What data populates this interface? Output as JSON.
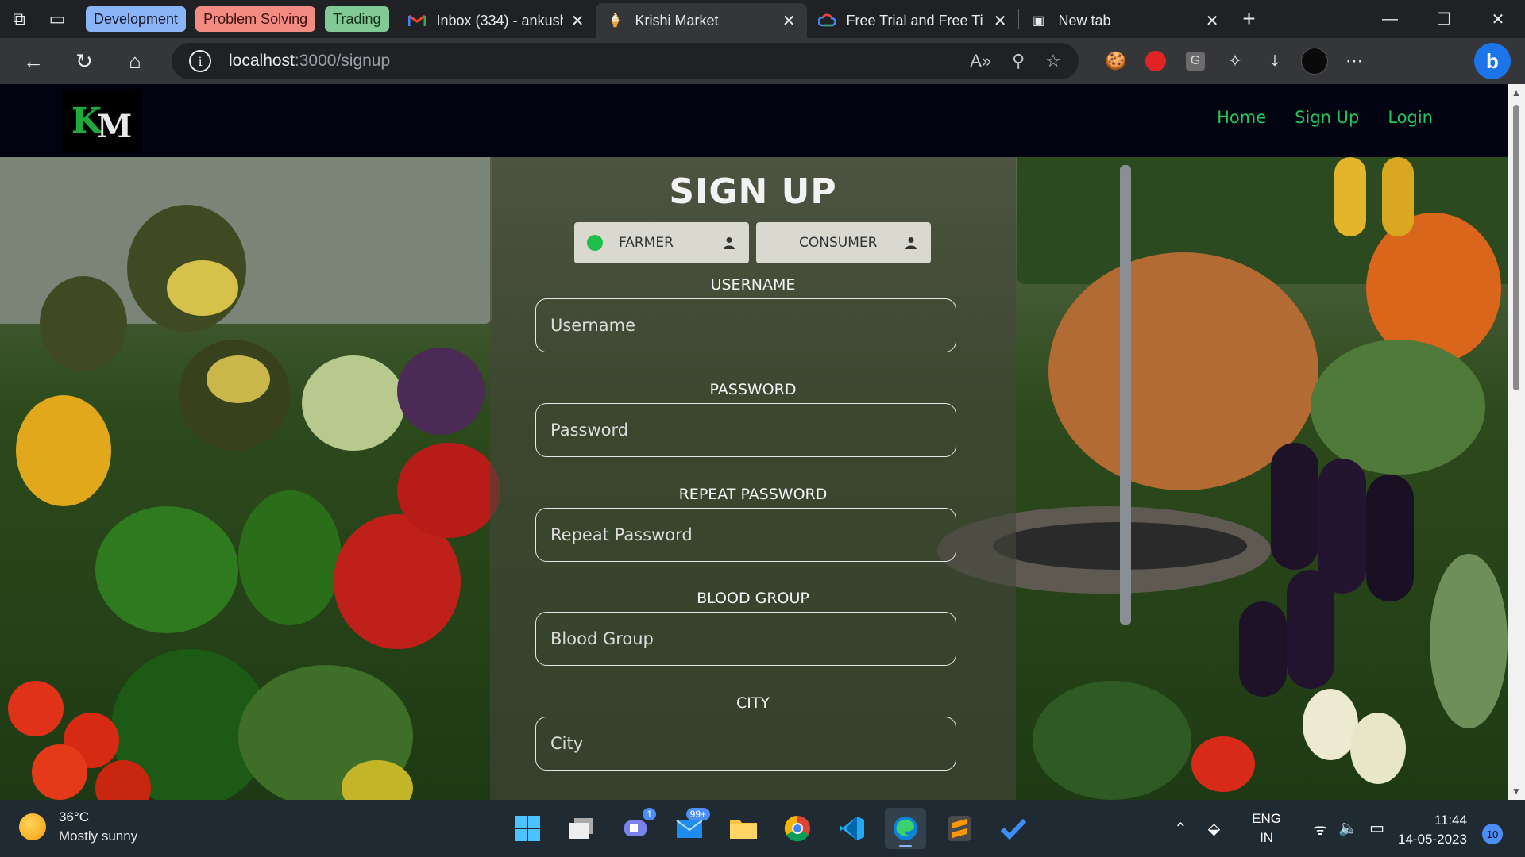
{
  "browser": {
    "tab_groups": [
      {
        "label": "Development"
      },
      {
        "label": "Problem Solving"
      },
      {
        "label": "Trading"
      }
    ],
    "tabs": [
      {
        "title": "Inbox (334) - ankushl"
      },
      {
        "title": "Krishi Market"
      },
      {
        "title": "Free Trial and Free Ti"
      },
      {
        "title": "New tab"
      }
    ],
    "address": {
      "host": "localhost",
      "path": ":3000/signup"
    }
  },
  "site": {
    "logo": {
      "k": "K",
      "m": "M"
    },
    "nav": {
      "home": "Home",
      "signup": "Sign Up",
      "login": "Login"
    },
    "form": {
      "title": "SIGN UP",
      "roles": {
        "farmer": "FARMER",
        "consumer": "CONSUMER"
      },
      "selected_role": "farmer",
      "fields": [
        {
          "label": "USERNAME",
          "placeholder": "Username",
          "value": ""
        },
        {
          "label": "PASSWORD",
          "placeholder": "Password",
          "value": ""
        },
        {
          "label": "REPEAT PASSWORD",
          "placeholder": "Repeat Password",
          "value": ""
        },
        {
          "label": "BLOOD GROUP",
          "placeholder": "Blood Group",
          "value": ""
        },
        {
          "label": "CITY",
          "placeholder": "City",
          "value": ""
        }
      ]
    }
  },
  "taskbar": {
    "weather": {
      "temp": "36°C",
      "condition": "Mostly sunny"
    },
    "badges": {
      "teams": "1",
      "mail": "99+"
    },
    "language": {
      "lang": "ENG",
      "region": "IN"
    },
    "clock": {
      "time": "11:44",
      "date": "14-05-2023"
    },
    "notifications": "10"
  },
  "colors": {
    "accent_green": "#22c55e",
    "header_bg": "#010410"
  }
}
